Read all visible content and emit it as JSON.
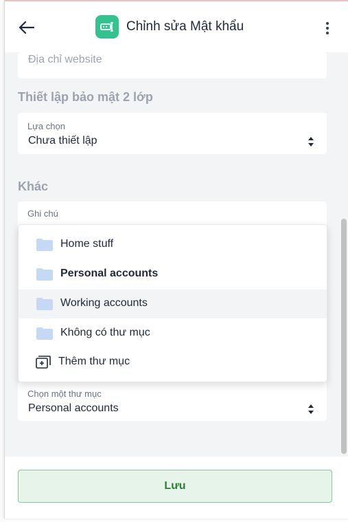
{
  "header": {
    "title": "Chỉnh sửa Mật khẩu",
    "back_icon": "arrow-left-icon",
    "app_icon": "password-manager-icon",
    "menu_icon": "kebab-menu-icon"
  },
  "fields": {
    "website": {
      "placeholder": "Địa chỉ website"
    },
    "two_factor": {
      "section_title": "Thiết lập bảo mật 2 lớp",
      "label": "Lựa chọn",
      "value": "Chưa thiết lập"
    },
    "other": {
      "section_title": "Khác",
      "note_label": "Ghi chú"
    },
    "folder": {
      "label": "Chọn một thư mục",
      "value": "Personal accounts"
    }
  },
  "folder_dropdown": {
    "items": [
      {
        "label": "Home stuff",
        "icon": "folder-icon"
      },
      {
        "label": "Personal accounts",
        "icon": "folder-icon",
        "selected": true
      },
      {
        "label": "Working accounts",
        "icon": "folder-icon",
        "hovered": true
      },
      {
        "label": "Không có thư mục",
        "icon": "folder-icon"
      },
      {
        "label": "Thêm thư mục",
        "icon": "add-folder-icon"
      }
    ]
  },
  "footer": {
    "save_label": "Lưu"
  },
  "colors": {
    "accent": "#34c38f",
    "save_bg": "#e6f4ea",
    "save_border": "#86c79d",
    "save_text": "#2e7d32",
    "folder_fill": "#c5d9f5"
  }
}
